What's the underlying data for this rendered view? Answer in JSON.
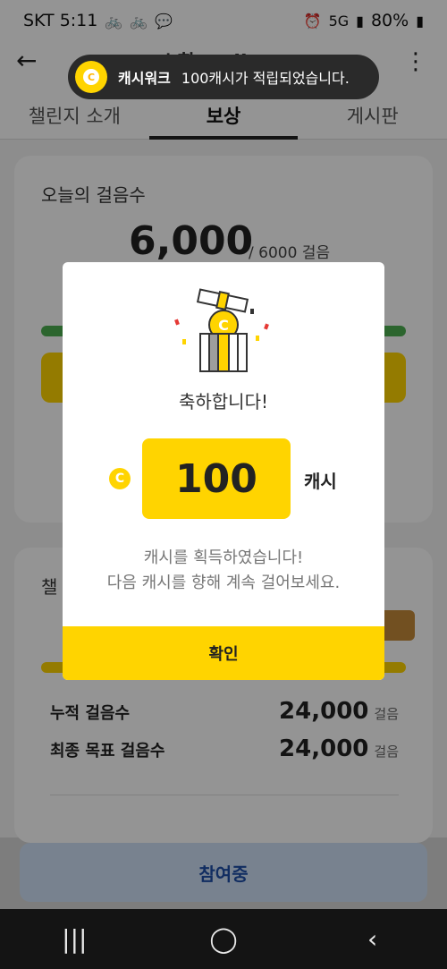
{
  "status_bar": {
    "carrier_time": "SKT 5:11",
    "battery": "80%",
    "network": "5G"
  },
  "header": {
    "title": "소환 walkers"
  },
  "tabs": [
    {
      "label": "챌린지 소개"
    },
    {
      "label": "보상"
    },
    {
      "label": "게시판"
    }
  ],
  "today_card": {
    "title": "오늘의 걸음수",
    "steps": "6,000",
    "goal": "/ 6000 걸음"
  },
  "summary_card": {
    "title": "챌",
    "rows": [
      {
        "label": "누적 걸음수",
        "value": "24,000",
        "unit": "걸음"
      },
      {
        "label": "최종 목표 걸음수",
        "value": "24,000",
        "unit": "걸음"
      }
    ]
  },
  "join_button": {
    "label": "참여중"
  },
  "toast": {
    "app_name": "캐시워크",
    "message": "100캐시가 적립되었습니다."
  },
  "dialog": {
    "title": "축하합니다!",
    "coin_symbol": "C",
    "amount": "100",
    "unit": "캐시",
    "message_line1": "캐시를 획득하였습니다!",
    "message_line2": "다음 캐시를 향해 계속 걸어보세요.",
    "confirm_label": "확인"
  },
  "nav": {
    "recent": "|||",
    "home": "◯",
    "back": "‹"
  },
  "colors": {
    "accent_yellow": "#ffd400",
    "progress_green": "#4caf50",
    "join_blue": "#1e4ea8"
  }
}
